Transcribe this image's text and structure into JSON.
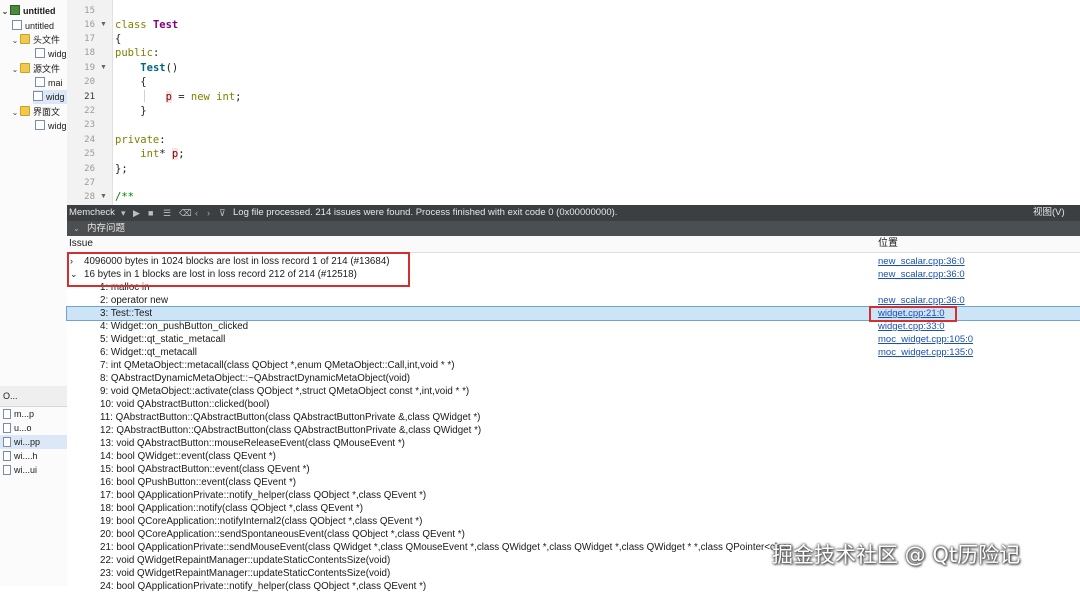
{
  "tree": {
    "project": "untitled",
    "pro_file": "untitled",
    "headers_folder": "头文件",
    "header_file": "widg",
    "sources_folder": "源文件",
    "source_main": "mai",
    "source_widget": "widg",
    "forms_folder": "界面文",
    "form_file": "widg"
  },
  "open_docs": {
    "header": "O...",
    "items": [
      "m...p",
      "u...o",
      "wi...pp",
      "wi....h",
      "wi...ui"
    ]
  },
  "editor": {
    "line_numbers": [
      "15",
      "16",
      "17",
      "18",
      "19",
      "20",
      "21",
      "22",
      "23",
      "24",
      "25",
      "26",
      "27",
      "28"
    ],
    "current_line": "21"
  },
  "toolbar": {
    "tool": "Memcheck",
    "message": "Log file processed. 214 issues were found. Process finished with exit code 0 (0x00000000).",
    "view": "视图(V)",
    "subtab": "内存问题"
  },
  "issues": {
    "col_issue": "Issue",
    "col_location": "位置",
    "records": [
      {
        "text": "4096000 bytes in 1024 blocks are lost in loss record 1 of 214 (#13684)",
        "loc": "new_scalar.cpp:36:0"
      },
      {
        "text": "16 bytes in 1 blocks are lost in loss record 212 of 214 (#12518)",
        "loc": "new_scalar.cpp:36:0"
      }
    ],
    "frames": [
      {
        "text": "1: malloc in",
        "loc": ""
      },
      {
        "text": "2: operator new",
        "loc": "new_scalar.cpp:36:0"
      },
      {
        "text": "3: Test::Test",
        "loc": "widget.cpp:21:0"
      },
      {
        "text": "4: Widget::on_pushButton_clicked",
        "loc": "widget.cpp:33:0"
      },
      {
        "text": "5: Widget::qt_static_metacall",
        "loc": "moc_widget.cpp:105:0"
      },
      {
        "text": "6: Widget::qt_metacall",
        "loc": "moc_widget.cpp:135:0"
      },
      {
        "text": "7: int QMetaObject::metacall(class QObject *,enum QMetaObject::Call,int,void * *)",
        "loc": ""
      },
      {
        "text": "8: QAbstractDynamicMetaObject::~QAbstractDynamicMetaObject(void)",
        "loc": ""
      },
      {
        "text": "9: void QMetaObject::activate(class QObject *,struct QMetaObject const *,int,void * *)",
        "loc": ""
      },
      {
        "text": "10: void QAbstractButton::clicked(bool)",
        "loc": ""
      },
      {
        "text": "11: QAbstractButton::QAbstractButton(class QAbstractButtonPrivate &,class QWidget *)",
        "loc": ""
      },
      {
        "text": "12: QAbstractButton::QAbstractButton(class QAbstractButtonPrivate &,class QWidget *)",
        "loc": ""
      },
      {
        "text": "13: void QAbstractButton::mouseReleaseEvent(class QMouseEvent *)",
        "loc": ""
      },
      {
        "text": "14: bool QWidget::event(class QEvent *)",
        "loc": ""
      },
      {
        "text": "15: bool QAbstractButton::event(class QEvent *)",
        "loc": ""
      },
      {
        "text": "16: bool QPushButton::event(class QEvent *)",
        "loc": ""
      },
      {
        "text": "17: bool QApplicationPrivate::notify_helper(class QObject *,class QEvent *)",
        "loc": ""
      },
      {
        "text": "18: bool QApplication::notify(class QObject *,class QEvent *)",
        "loc": ""
      },
      {
        "text": "19: bool QCoreApplication::notifyInternal2(class QObject *,class QEvent *)",
        "loc": ""
      },
      {
        "text": "20: bool QCoreApplication::sendSpontaneousEvent(class QObject *,class QEvent *)",
        "loc": ""
      },
      {
        "text": "21: bool QApplicationPrivate::sendMouseEvent(class QWidget *,class QMouseEvent *,class QWidget *,class QWidget *,class QWidget * *,class QPointer<class",
        "loc": ""
      },
      {
        "text": "22: void QWidgetRepaintManager::updateStaticContentsSize(void)",
        "loc": ""
      },
      {
        "text": "23: void QWidgetRepaintManager::updateStaticContentsSize(void)",
        "loc": ""
      },
      {
        "text": "24: bool QApplicationPrivate::notify_helper(class QObject *,class QEvent *)",
        "loc": ""
      }
    ]
  },
  "watermark": "掘金技术社区 @ Qt历险记"
}
